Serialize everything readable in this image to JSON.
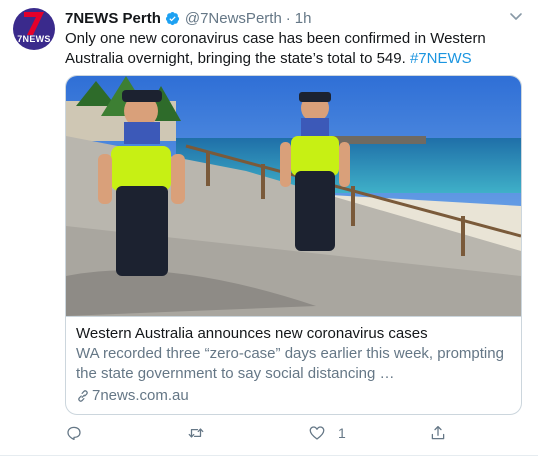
{
  "tweet": {
    "author_name": "7NEWS Perth",
    "handle": "@7NewsPerth",
    "separator": "·",
    "time": "1h",
    "text": "Only one new coronavirus case has been confirmed in Western Australia overnight, bringing the state’s total to 549.",
    "hashtag": "#7NEWS",
    "avatar_text": "7NEWS"
  },
  "card": {
    "title": "Western Australia announces new coronavirus cases",
    "description": "WA recorded three “zero-case” days earlier this week, prompting the state government to say social distancing …",
    "domain": "7news.com.au"
  },
  "actions": {
    "reply_count": "",
    "retweet_count": "",
    "like_count": "1",
    "share_count": ""
  },
  "icons": {
    "verified": "verified-badge-icon",
    "chevron": "chevron-down-icon",
    "reply": "reply-icon",
    "retweet": "retweet-icon",
    "like": "heart-icon",
    "share": "share-icon",
    "link": "link-icon"
  },
  "colors": {
    "link_blue": "#1b95e0",
    "secondary_text": "#657786",
    "avatar_bg": "#3a2a8c",
    "avatar_accent": "#e4002b"
  }
}
